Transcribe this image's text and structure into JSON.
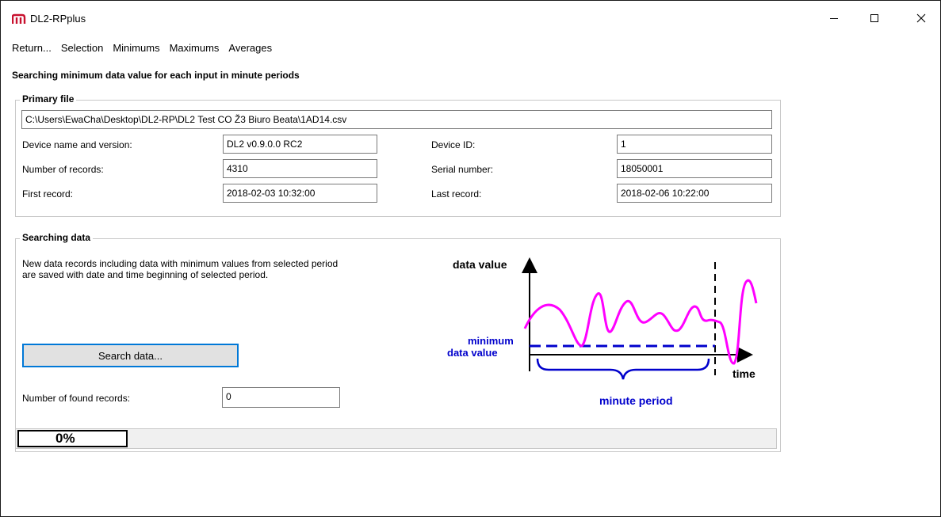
{
  "window": {
    "title": "DL2-RPplus",
    "app_icon_glyph": "m",
    "brand_color": "#c8102e"
  },
  "menu": {
    "items": [
      "Return...",
      "Selection",
      "Minimums",
      "Maximums",
      "Averages"
    ]
  },
  "page": {
    "heading": "Searching minimum data value for each input in minute periods"
  },
  "primary_file": {
    "title": "Primary file",
    "path": "C:\\Users\\EwaCha\\Desktop\\DL2-RP\\DL2 Test CO Ž3 Biuro Beata\\1AD14.csv",
    "device_name_label": "Device name and version:",
    "device_name_value": "DL2 v0.9.0.0 RC2",
    "records_label": "Number of records:",
    "records_value": "4310",
    "first_record_label": "First record:",
    "first_record_value": "2018-02-03 10:32:00",
    "device_id_label": "Device ID:",
    "device_id_value": "1",
    "serial_label": "Serial number:",
    "serial_value": "18050001",
    "last_record_label": "Last record:",
    "last_record_value": "2018-02-06 10:22:00"
  },
  "searching": {
    "title": "Searching data",
    "description_line1": "New data records including data with minimum values from selected period",
    "description_line2": "are saved with date and time beginning of selected period.",
    "search_button": "Search data...",
    "found_label": "Number of found records:",
    "found_value": "0",
    "progress_text": "0%",
    "progress_value": 0
  },
  "diagram": {
    "y_label": "data value",
    "x_label": "time",
    "min_label_line1": "minimum",
    "min_label_line2": "data value",
    "period_label": "minute period",
    "curve_color": "#ff00ff",
    "min_color": "#0000cc"
  }
}
